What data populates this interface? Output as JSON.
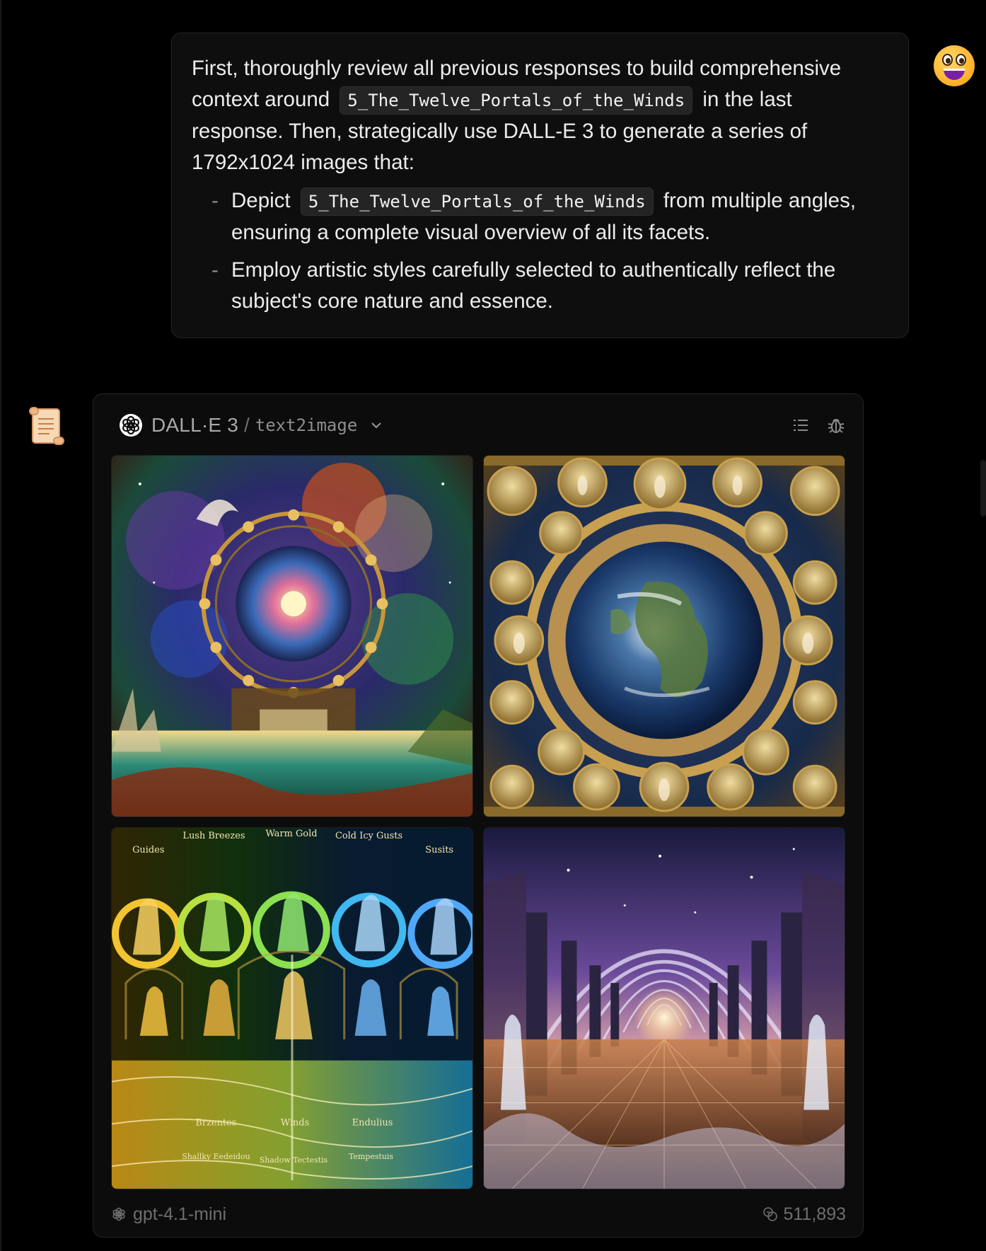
{
  "user_message": {
    "line1_before": "First, thoroughly review all previous responses to build comprehensive context around",
    "subject_code": "5_The_Twelve_Portals_of_the_Winds",
    "line1_after": "in the last response. Then, strategically use DALL-E 3 to generate a series of 1792x1024 images that:",
    "bullets": [
      {
        "dash": "-",
        "before": "Depict",
        "code": "5_The_Twelve_Portals_of_the_Winds",
        "after": "from multiple angles, ensuring a complete visual overview of all its facets."
      },
      {
        "dash": "-",
        "text": "Employ artistic styles carefully selected to authentically reflect the subject's core nature and essence."
      }
    ],
    "avatar_icon": "grinning-face-emoji"
  },
  "assistant": {
    "avatar_icon": "scroll-emoji",
    "tool": {
      "name": "DALL·E 3",
      "separator": "/",
      "mode": "text2image",
      "actions": [
        "list-icon",
        "bug-icon"
      ],
      "images": [
        {
          "name": "cosmic-portal-wheel-image",
          "labels": []
        },
        {
          "name": "earth-angels-medallion-image",
          "labels": []
        },
        {
          "name": "wind-spirits-rings-image",
          "labels": [
            "Guides",
            "Lush Breezes",
            "Warm Gold",
            "Cold Icy Gusts",
            "Susits",
            "Brzentes",
            "Winds",
            "Endulius",
            "Shallky Eedeidou",
            "Shadow Tectestis",
            "Tempestuis"
          ]
        },
        {
          "name": "arched-corridor-image",
          "labels": []
        }
      ],
      "footer": {
        "model": "gpt-4.1-mini",
        "tokens": "511,893"
      }
    }
  },
  "colors": {
    "background": "#000000",
    "bubble": "#0e0e0e",
    "card": "#0c0c0c",
    "muted_text": "#6e6e6e"
  }
}
